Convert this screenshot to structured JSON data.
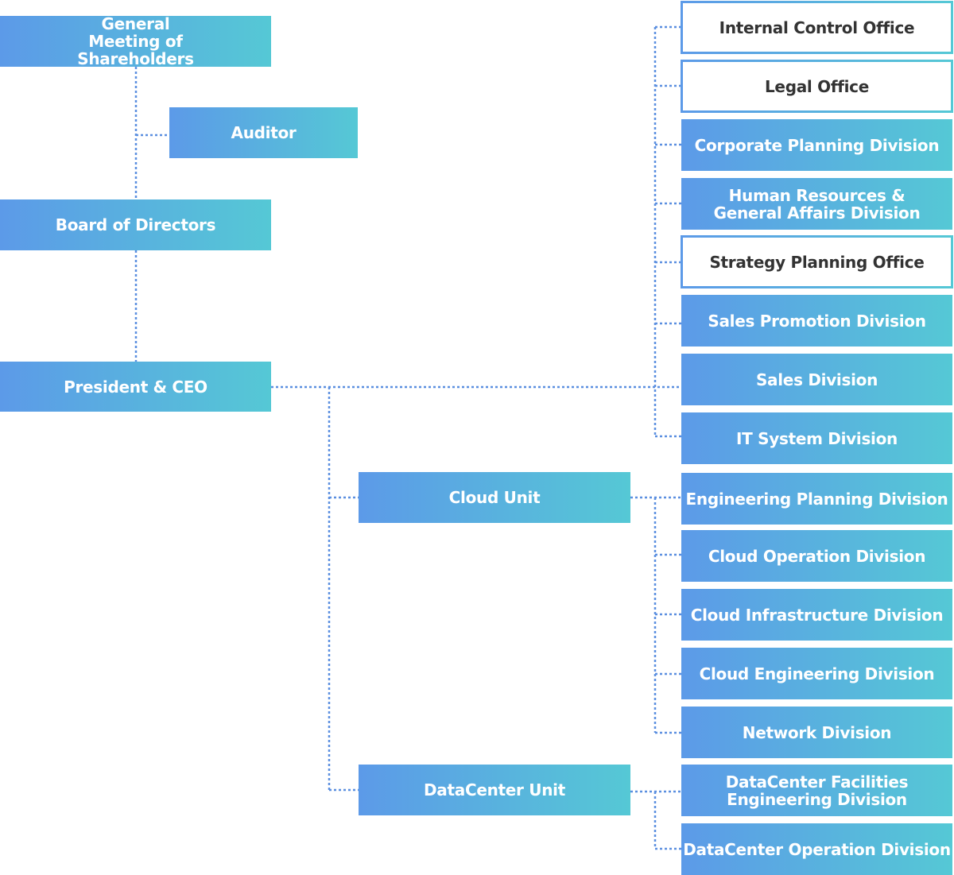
{
  "colors": {
    "gradient_start": "#5c9ae8",
    "gradient_end": "#55c8d5",
    "connector": "#5b8fe0",
    "outline_text": "#333333"
  },
  "governance": {
    "general_meeting": "General Meeting of Shareholders",
    "auditor": "Auditor",
    "board": "Board of Directors",
    "president": "President & CEO"
  },
  "units": {
    "cloud": "Cloud Unit",
    "datacenter": "DataCenter Unit"
  },
  "corporate_divisions": [
    {
      "label": "Internal Control Office",
      "style": "outline"
    },
    {
      "label": "Legal Office",
      "style": "outline"
    },
    {
      "label": "Corporate Planning Division",
      "style": "filled"
    },
    {
      "label": "Human Resources & General Affairs Division",
      "style": "filled"
    },
    {
      "label": "Strategy Planning Office",
      "style": "outline"
    },
    {
      "label": "Sales Promotion Division",
      "style": "filled"
    },
    {
      "label": "Sales Division",
      "style": "filled"
    },
    {
      "label": "IT System Division",
      "style": "filled"
    }
  ],
  "cloud_divisions": [
    {
      "label": "Engineering Planning Division"
    },
    {
      "label": "Cloud Operation Division"
    },
    {
      "label": "Cloud Infrastructure Division"
    },
    {
      "label": "Cloud Engineering Division"
    },
    {
      "label": "Network Division"
    }
  ],
  "datacenter_divisions": [
    {
      "label": "DataCenter Facilities Engineering Division"
    },
    {
      "label": "DataCenter Operation Division"
    }
  ]
}
